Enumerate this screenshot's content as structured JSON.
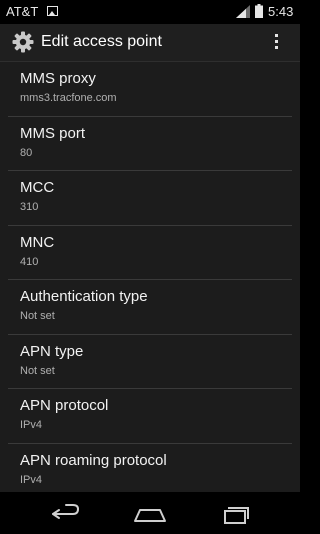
{
  "status_bar": {
    "carrier": "AT&T",
    "time": "5:43"
  },
  "action_bar": {
    "title": "Edit access point",
    "icon": "gear-icon",
    "overflow_icon": "overflow-menu-icon"
  },
  "items": [
    {
      "title": "MMS proxy",
      "summary": "mms3.tracfone.com"
    },
    {
      "title": "MMS port",
      "summary": "80"
    },
    {
      "title": "MCC",
      "summary": "310"
    },
    {
      "title": "MNC",
      "summary": "410"
    },
    {
      "title": "Authentication type",
      "summary": "Not set"
    },
    {
      "title": "APN type",
      "summary": "Not set"
    },
    {
      "title": "APN protocol",
      "summary": "IPv4"
    },
    {
      "title": "APN roaming protocol",
      "summary": "IPv4"
    }
  ],
  "nav_bar": {
    "buttons": [
      "back-icon",
      "home-icon",
      "recents-icon"
    ]
  },
  "colors": {
    "background": "#1c1c1c",
    "action_bar": "#1f1f1f",
    "divider": "#3a3a3a",
    "title_text": "#f2f2f2",
    "summary_text": "#b0b0b0"
  }
}
